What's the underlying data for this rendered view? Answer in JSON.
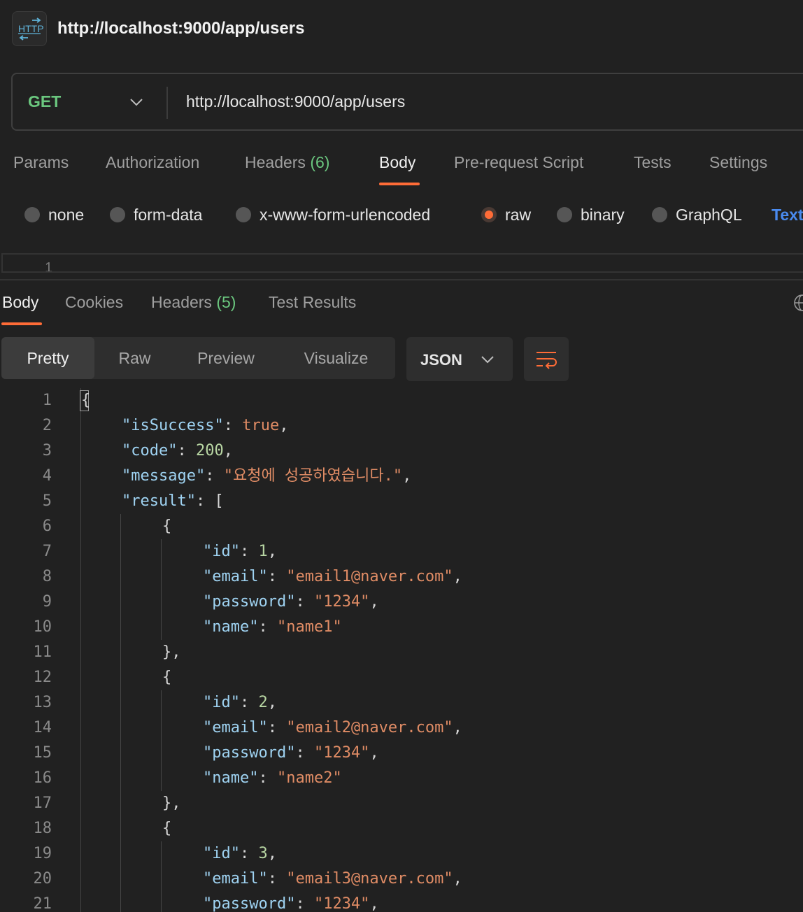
{
  "header": {
    "icon": "http-icon",
    "title": "http://localhost:9000/app/users"
  },
  "request": {
    "method": "GET",
    "url": "http://localhost:9000/app/users"
  },
  "request_tabs": {
    "params": "Params",
    "authorization": "Authorization",
    "headers": "Headers",
    "headers_count": "(6)",
    "body": "Body",
    "prerequest": "Pre-request Script",
    "tests": "Tests",
    "settings": "Settings"
  },
  "body_types": {
    "none": "none",
    "form_data": "form-data",
    "urlencoded": "x-www-form-urlencoded",
    "raw": "raw",
    "binary": "binary",
    "graphql": "GraphQL",
    "format": "Text",
    "selected": "raw"
  },
  "request_editor": {
    "first_line": "1"
  },
  "response_tabs": {
    "body": "Body",
    "cookies": "Cookies",
    "headers": "Headers",
    "headers_count": "(5)",
    "test_results": "Test Results"
  },
  "view_modes": {
    "pretty": "Pretty",
    "raw": "Raw",
    "preview": "Preview",
    "visualize": "Visualize",
    "selected": "Pretty"
  },
  "format_select": {
    "value": "JSON"
  },
  "colors": {
    "accent": "#ff6c37",
    "get_method": "#6bc77f",
    "json_key": "#9fd3f2",
    "json_string": "#e08c65",
    "json_number": "#b8d6a3"
  },
  "code_lines": [
    [
      {
        "t": "{",
        "c": "p"
      }
    ],
    [
      {
        "t": "\"isSuccess\"",
        "c": "k"
      },
      {
        "t": ": ",
        "c": "p"
      },
      {
        "t": "true",
        "c": "b"
      },
      {
        "t": ",",
        "c": "p"
      }
    ],
    [
      {
        "t": "\"code\"",
        "c": "k"
      },
      {
        "t": ": ",
        "c": "p"
      },
      {
        "t": "200",
        "c": "n"
      },
      {
        "t": ",",
        "c": "p"
      }
    ],
    [
      {
        "t": "\"message\"",
        "c": "k"
      },
      {
        "t": ": ",
        "c": "p"
      },
      {
        "t": "\"요청에 성공하였습니다.\"",
        "c": "s"
      },
      {
        "t": ",",
        "c": "p"
      }
    ],
    [
      {
        "t": "\"result\"",
        "c": "k"
      },
      {
        "t": ": [",
        "c": "p"
      }
    ],
    [
      {
        "t": "{",
        "c": "p"
      }
    ],
    [
      {
        "t": "\"id\"",
        "c": "k"
      },
      {
        "t": ": ",
        "c": "p"
      },
      {
        "t": "1",
        "c": "n"
      },
      {
        "t": ",",
        "c": "p"
      }
    ],
    [
      {
        "t": "\"email\"",
        "c": "k"
      },
      {
        "t": ": ",
        "c": "p"
      },
      {
        "t": "\"email1@naver.com\"",
        "c": "s"
      },
      {
        "t": ",",
        "c": "p"
      }
    ],
    [
      {
        "t": "\"password\"",
        "c": "k"
      },
      {
        "t": ": ",
        "c": "p"
      },
      {
        "t": "\"1234\"",
        "c": "s"
      },
      {
        "t": ",",
        "c": "p"
      }
    ],
    [
      {
        "t": "\"name\"",
        "c": "k"
      },
      {
        "t": ": ",
        "c": "p"
      },
      {
        "t": "\"name1\"",
        "c": "s"
      }
    ],
    [
      {
        "t": "},",
        "c": "p"
      }
    ],
    [
      {
        "t": "{",
        "c": "p"
      }
    ],
    [
      {
        "t": "\"id\"",
        "c": "k"
      },
      {
        "t": ": ",
        "c": "p"
      },
      {
        "t": "2",
        "c": "n"
      },
      {
        "t": ",",
        "c": "p"
      }
    ],
    [
      {
        "t": "\"email\"",
        "c": "k"
      },
      {
        "t": ": ",
        "c": "p"
      },
      {
        "t": "\"email2@naver.com\"",
        "c": "s"
      },
      {
        "t": ",",
        "c": "p"
      }
    ],
    [
      {
        "t": "\"password\"",
        "c": "k"
      },
      {
        "t": ": ",
        "c": "p"
      },
      {
        "t": "\"1234\"",
        "c": "s"
      },
      {
        "t": ",",
        "c": "p"
      }
    ],
    [
      {
        "t": "\"name\"",
        "c": "k"
      },
      {
        "t": ": ",
        "c": "p"
      },
      {
        "t": "\"name2\"",
        "c": "s"
      }
    ],
    [
      {
        "t": "},",
        "c": "p"
      }
    ],
    [
      {
        "t": "{",
        "c": "p"
      }
    ],
    [
      {
        "t": "\"id\"",
        "c": "k"
      },
      {
        "t": ": ",
        "c": "p"
      },
      {
        "t": "3",
        "c": "n"
      },
      {
        "t": ",",
        "c": "p"
      }
    ],
    [
      {
        "t": "\"email\"",
        "c": "k"
      },
      {
        "t": ": ",
        "c": "p"
      },
      {
        "t": "\"email3@naver.com\"",
        "c": "s"
      },
      {
        "t": ",",
        "c": "p"
      }
    ],
    [
      {
        "t": "\"password\"",
        "c": "k"
      },
      {
        "t": ": ",
        "c": "p"
      },
      {
        "t": "\"1234\"",
        "c": "s"
      },
      {
        "t": ",",
        "c": "p"
      }
    ]
  ]
}
